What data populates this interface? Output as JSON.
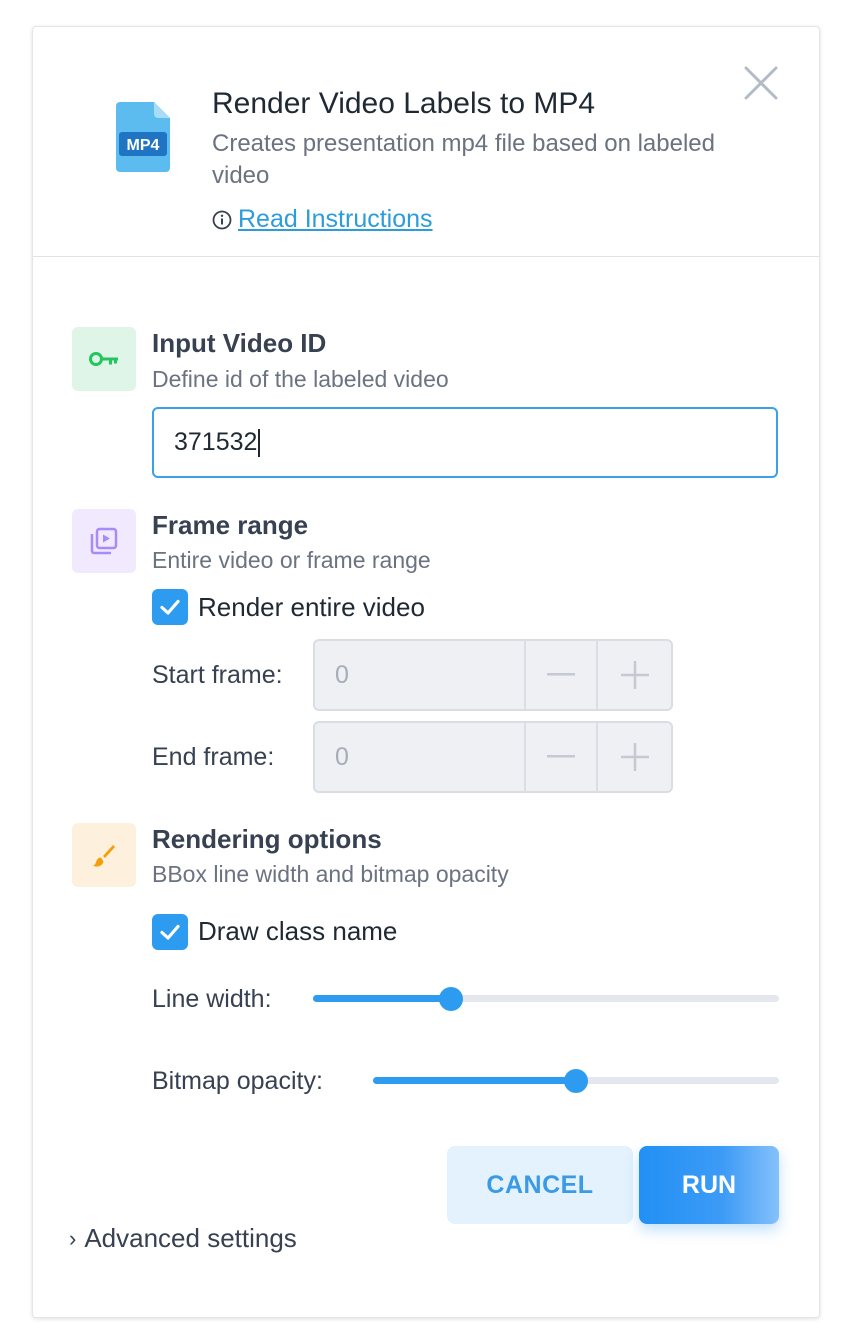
{
  "app": {
    "title": "Render Video Labels to MP4",
    "description": "Creates presentation mp4 file based on labeled video",
    "instructions_link": "Read Instructions",
    "icon_label": "MP4"
  },
  "input_video": {
    "title": "Input Video ID",
    "subtitle": "Define id of the labeled video",
    "value": "371532"
  },
  "frame_range": {
    "title": "Frame range",
    "subtitle": "Entire video or frame range",
    "checkbox_label": "Render entire video",
    "checked": true,
    "start_label": "Start frame:",
    "start_value": "0",
    "end_label": "End frame:",
    "end_value": "0"
  },
  "rendering": {
    "title": "Rendering options",
    "subtitle": "BBox line width and bitmap opacity",
    "checkbox_label": "Draw class name",
    "checked": true,
    "line_width_label": "Line width:",
    "line_width_fraction": 0.297,
    "opacity_label": "Bitmap opacity:",
    "opacity_fraction": 0.5
  },
  "buttons": {
    "cancel": "CANCEL",
    "run": "RUN"
  },
  "advanced": "Advanced settings",
  "colors": {
    "accent": "#2d9cf0",
    "link": "#2d9cdb",
    "key_icon": "#22c55e",
    "frame_icon": "#a78bfa",
    "brush_icon": "#f59e0b"
  }
}
